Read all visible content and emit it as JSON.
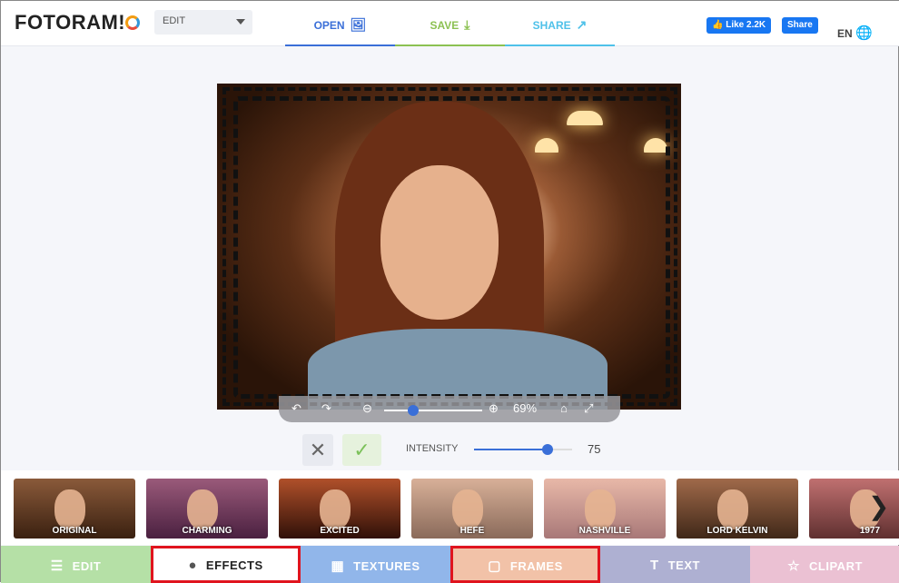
{
  "header": {
    "logo": "FOTORAM!O",
    "mode": "EDIT",
    "nav": [
      {
        "label": "OPEN",
        "icon": "image-icon",
        "color": "#3a6fd8"
      },
      {
        "label": "SAVE",
        "icon": "download-icon",
        "color": "#8cc152"
      },
      {
        "label": "SHARE",
        "icon": "share-icon",
        "color": "#4fc1e9"
      }
    ],
    "like": "Like 2.2K",
    "share": "Share",
    "lang": "EN"
  },
  "viewer": {
    "zoom": "69%",
    "zoom_level": 0.3
  },
  "effect": {
    "intensity_label": "INTENSITY",
    "intensity": "75",
    "intensity_fraction": 0.75
  },
  "effects": [
    "ORIGINAL",
    "CHARMING",
    "EXCITED",
    "HEFE",
    "NASHVILLE",
    "LORD KELVIN",
    "1977"
  ],
  "tabs": [
    {
      "label": "EDIT",
      "icon": "sliders-icon",
      "color": "#b5e0a6"
    },
    {
      "label": "EFFECTS",
      "icon": "effects-icon",
      "color": "#ffffff",
      "selected": true
    },
    {
      "label": "TEXTURES",
      "icon": "grid-icon",
      "color": "#91b6ea"
    },
    {
      "label": "FRAMES",
      "icon": "frame-icon",
      "color": "#f2c2a8"
    },
    {
      "label": "TEXT",
      "icon": "text-icon",
      "color": "#aeb0d2"
    },
    {
      "label": "CLIPART",
      "icon": "star-icon",
      "color": "#ebc1d3"
    }
  ]
}
